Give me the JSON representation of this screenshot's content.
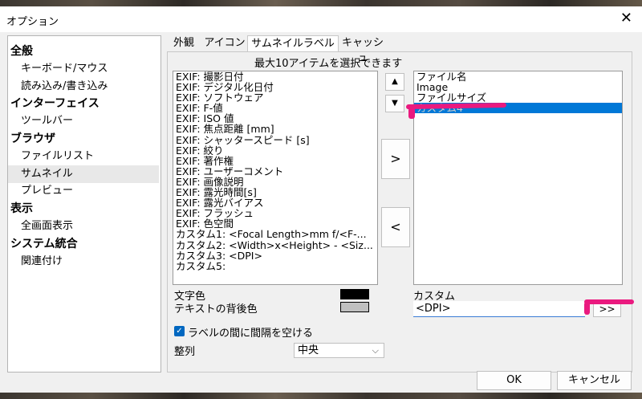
{
  "dialog": {
    "title": "オプション",
    "close_icon": "close-icon"
  },
  "categories": [
    {
      "label": "全般",
      "type": "header"
    },
    {
      "label": "キーボード/マウス",
      "type": "sub"
    },
    {
      "label": "読み込み/書き込み",
      "type": "sub"
    },
    {
      "label": "インターフェイス",
      "type": "header"
    },
    {
      "label": "ツールバー",
      "type": "sub"
    },
    {
      "label": "ブラウザ",
      "type": "header"
    },
    {
      "label": "ファイルリスト",
      "type": "sub"
    },
    {
      "label": "サムネイル",
      "type": "sub",
      "selected": true
    },
    {
      "label": "プレビュー",
      "type": "sub"
    },
    {
      "label": "表示",
      "type": "header"
    },
    {
      "label": "全画面表示",
      "type": "sub"
    },
    {
      "label": "システム統合",
      "type": "header"
    },
    {
      "label": "関連付け",
      "type": "sub"
    }
  ],
  "tabs": [
    {
      "label": "外観"
    },
    {
      "label": "アイコン"
    },
    {
      "label": "サムネイルラベル",
      "active": true
    },
    {
      "label": "キャッシュ"
    }
  ],
  "labels_panel": {
    "hint": "最大10アイテムを選択できます",
    "available": [
      "EXIF: 撮影日付",
      "EXIF: デジタル化日付",
      "EXIF: ソフトウェア",
      "EXIF: F-値",
      "EXIF: ISO 値",
      "EXIF: 焦点距離 [mm]",
      "EXIF: シャッタースピード [s]",
      "EXIF: 絞り",
      "EXIF: 著作権",
      "EXIF: ユーザーコメント",
      "EXIF: 画像説明",
      "EXIF: 露光時間[s]",
      "EXIF: 露光バイアス",
      "EXIF: フラッシュ",
      "EXIF: 色空間",
      "カスタム1: <Focal Length>mm f/<F-...",
      "カスタム2: <Width>x<Height> - <Siz...",
      "カスタム3: <DPI>",
      "カスタム5:"
    ],
    "selected": [
      "ファイル名",
      "Image",
      "ファイルサイズ",
      "カスタム4"
    ],
    "selected_index": 3,
    "up_arrow": "▲",
    "down_arrow": "▼",
    "add_button": ">",
    "remove_button": "<",
    "text_color_label": "文字色",
    "text_bg_label": "テキストの背後色",
    "text_color": "#000000",
    "text_bg_color": "#c0c0c0",
    "custom_label": "カスタム",
    "custom_value": "<DPI>",
    "custom_more_button": ">>",
    "spacing_checkbox_label": "ラベルの間に間隔を空ける",
    "spacing_checked": true,
    "align_label": "整列",
    "align_value": "中央"
  },
  "footer": {
    "ok_label": "OK",
    "cancel_label": "キャンセル"
  },
  "colors": {
    "highlight": "#0078d7",
    "annotation": "#ea1a7f"
  }
}
